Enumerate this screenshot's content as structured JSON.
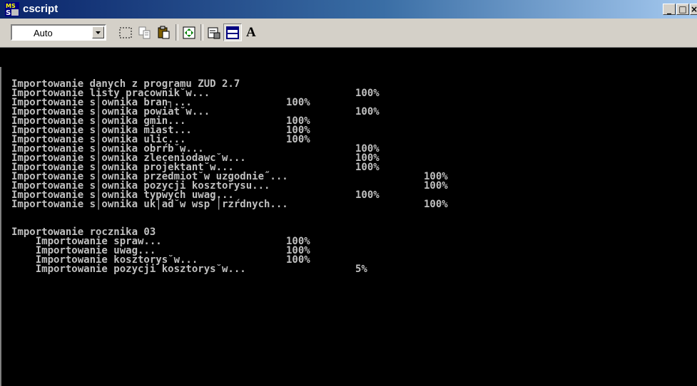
{
  "window": {
    "title": "cscript",
    "icon": "ms-dos-icon",
    "controls": {
      "minimize": "_",
      "maximize": "□",
      "close": "×"
    }
  },
  "toolbar": {
    "font_size_value": "Auto",
    "buttons": [
      "mark-icon",
      "copy-icon",
      "paste-icon",
      "fullscreen-icon",
      "properties-icon",
      "background-icon",
      "font-icon"
    ],
    "font_button_label": "A"
  },
  "console": {
    "lines": [
      {
        "text": "Importowanie danych z programu ZUD 2.7",
        "pct": ""
      },
      {
        "text": "Importowanie listy pracownik˘w...",
        "pct": "100%"
      },
      {
        "text": "Importowanie s│ownika bran┐... ",
        "pct": "100%"
      },
      {
        "text": "Importowanie s│ownika powiat˘w...",
        "pct": "100%"
      },
      {
        "text": "Importowanie s│ownika gmin...  ",
        "pct": "100%"
      },
      {
        "text": "Importowanie s│ownika miast... ",
        "pct": "100%"
      },
      {
        "text": "Importowanie s│ownika ulic...  ",
        "pct": "100%"
      },
      {
        "text": "Importowanie s│ownika obrŕb˘w...",
        "pct": "100%"
      },
      {
        "text": "Importowanie s│ownika zleceniodawc˘w...",
        "pct": "100%"
      },
      {
        "text": "Importowanie s│ownika projektant˘w...",
        "pct": "100%"
      },
      {
        "text": "Importowanie s│ownika przedmiot˘w uzgodnie˝...",
        "pct": "100%"
      },
      {
        "text": "Importowanie s│ownika pozycji kosztorysu...",
        "pct": "100%"
      },
      {
        "text": "Importowanie s│ownika typwych uwag...",
        "pct": "100%"
      },
      {
        "text": "Importowanie s│ownika uk│ad˘w wsp˘│rzŕdnych...",
        "pct": "100%"
      },
      {
        "text": "",
        "pct": ""
      },
      {
        "text": "Importowanie rocznika 03",
        "pct": ""
      },
      {
        "text": "    Importowanie spraw...",
        "pct": "100%"
      },
      {
        "text": "    Importowanie uwag...",
        "pct": "100%"
      },
      {
        "text": "    Importowanie kosztorys˘w...",
        "pct": "100%"
      },
      {
        "text": "    Importowanie pozycji kosztorys˘w...",
        "pct": "5%"
      }
    ]
  }
}
